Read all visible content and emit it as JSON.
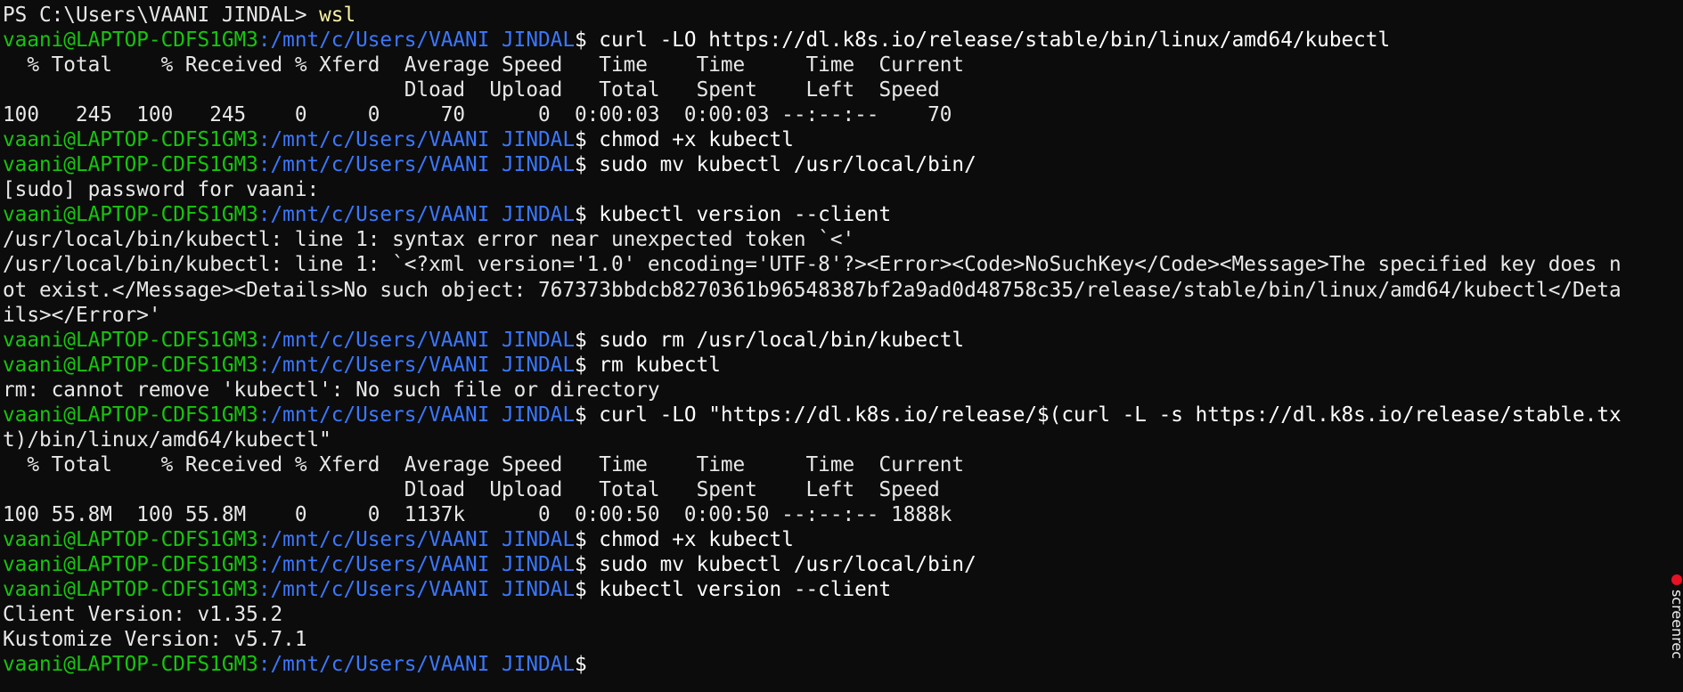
{
  "terminal": {
    "ps_prompt": "PS C:\\Users\\VAANI JINDAL> ",
    "ps_cmd": "wsl",
    "user_host": "vaani@LAPTOP-CDFS1GM3",
    "cwd": ":/mnt/c/Users/VAANI JINDAL",
    "commands": {
      "c1": "$ curl -LO https://dl.k8s.io/release/stable/bin/linux/amd64/kubectl",
      "c2": "$ chmod +x kubectl",
      "c3": "$ sudo mv kubectl /usr/local/bin/",
      "c4": "$ kubectl version --client",
      "c5": "$ sudo rm /usr/local/bin/kubectl",
      "c6": "$ rm kubectl",
      "c7": "$ curl -LO \"https://dl.k8s.io/release/$(curl -L -s https://dl.k8s.io/release/stable.tx",
      "c8": "$ chmod +x kubectl",
      "c9": "$ sudo mv kubectl /usr/local/bin/",
      "c10": "$ kubectl version --client",
      "c11": "$"
    },
    "output": {
      "o1a": "  % Total    % Received % Xferd  Average Speed   Time    Time     Time  Current",
      "o1b": "                                 Dload  Upload   Total   Spent    Left  Speed",
      "o1c": "100   245  100   245    0     0     70      0  0:00:03  0:00:03 --:--:--    70",
      "o2": "[sudo] password for vaani:",
      "o3a": "/usr/local/bin/kubectl: line 1: syntax error near unexpected token `<'",
      "o3b": "/usr/local/bin/kubectl: line 1: `<?xml version='1.0' encoding='UTF-8'?><Error><Code>NoSuchKey</Code><Message>The specified key does n",
      "o3c": "ot exist.</Message><Details>No such object: 767373bbdcb8270361b96548387bf2a9ad0d48758c35/release/stable/bin/linux/amd64/kubectl</Deta",
      "o3d": "ils></Error>'",
      "o4": "rm: cannot remove 'kubectl': No such file or directory",
      "o5": "t)/bin/linux/amd64/kubectl\"",
      "o6a": "  % Total    % Received % Xferd  Average Speed   Time    Time     Time  Current",
      "o6b": "                                 Dload  Upload   Total   Spent    Left  Speed",
      "o6c": "100 55.8M  100 55.8M    0     0  1137k      0  0:00:50  0:00:50 --:--:-- 1888k",
      "o7": "Client Version: v1.35.2",
      "o8": "Kustomize Version: v5.7.1"
    }
  },
  "overlay": {
    "label": "screenrec"
  }
}
